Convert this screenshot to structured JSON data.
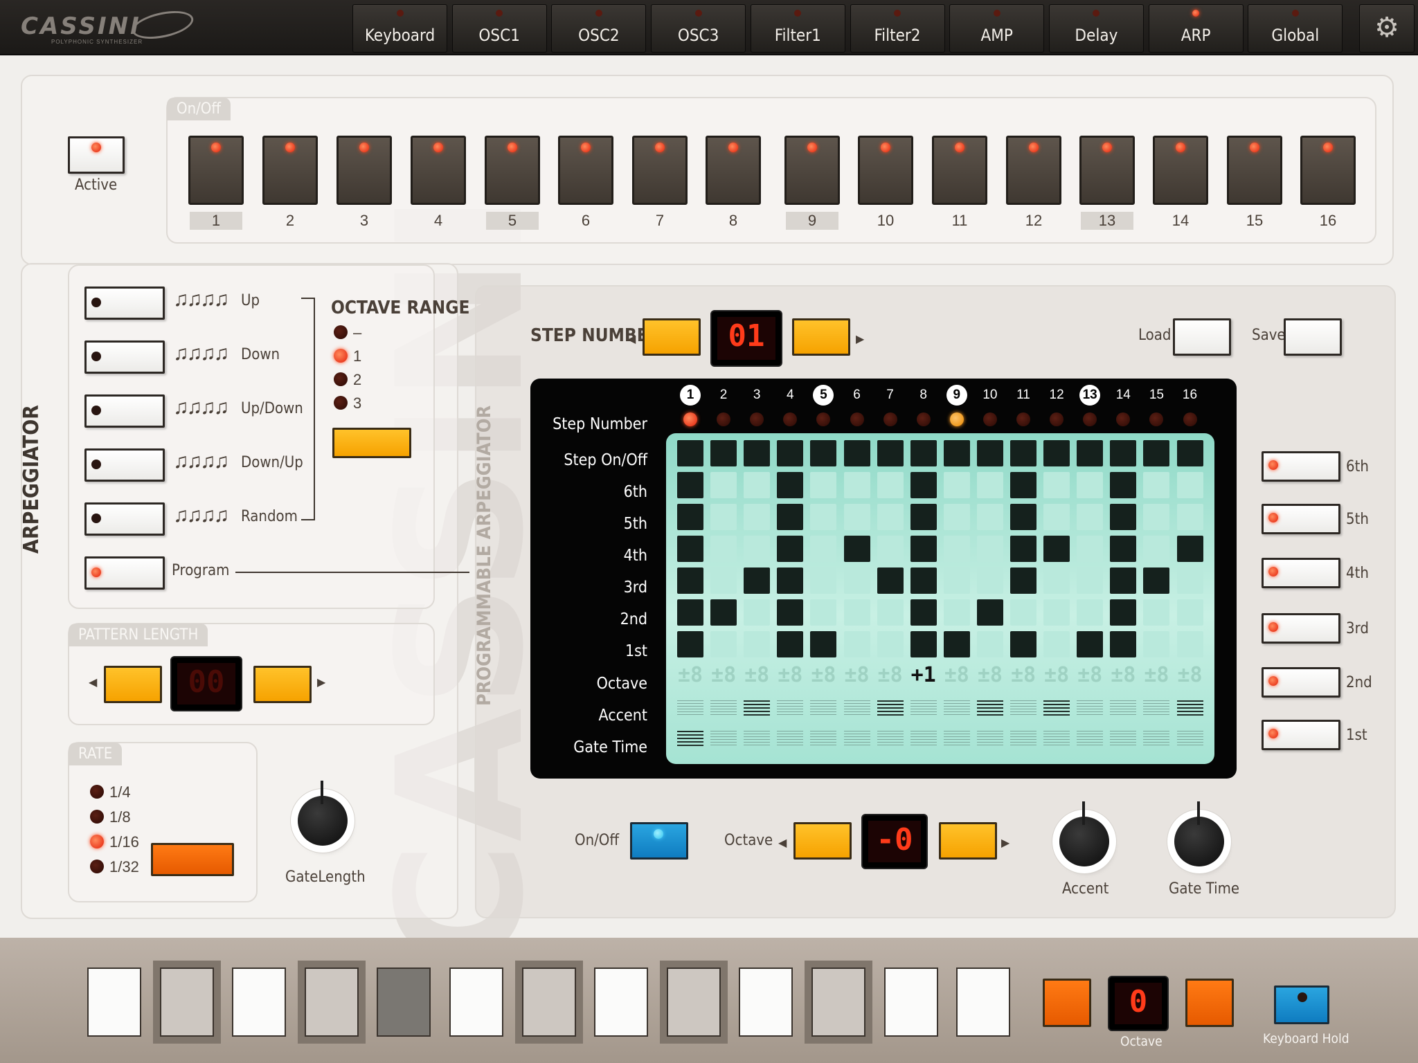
{
  "app": {
    "logo": "CASSINI",
    "logo_sub": "POLYPHONIC SYNTHESIZER"
  },
  "tabs": [
    {
      "label": "Keyboard",
      "active": false
    },
    {
      "label": "OSC1",
      "active": false
    },
    {
      "label": "OSC2",
      "active": false
    },
    {
      "label": "OSC3",
      "active": false
    },
    {
      "label": "Filter1",
      "active": false
    },
    {
      "label": "Filter2",
      "active": false
    },
    {
      "label": "AMP",
      "active": false
    },
    {
      "label": "Delay",
      "active": false
    },
    {
      "label": "ARP",
      "active": true
    },
    {
      "label": "Global",
      "active": false
    }
  ],
  "arp_section": {
    "title": "ARPEGGIATOR",
    "on_off_tag": "On/Off",
    "active_label": "Active",
    "steps": [
      "1",
      "2",
      "3",
      "4",
      "5",
      "6",
      "7",
      "8",
      "9",
      "10",
      "11",
      "12",
      "13",
      "14",
      "15",
      "16"
    ],
    "highlighted_steps": [
      1,
      5,
      9,
      13
    ],
    "modes": [
      {
        "label": "Up",
        "on": false
      },
      {
        "label": "Down",
        "on": false
      },
      {
        "label": "Up/Down",
        "on": false
      },
      {
        "label": "Down/Up",
        "on": false
      },
      {
        "label": "Random",
        "on": false
      },
      {
        "label": "Program",
        "on": true
      }
    ],
    "octave_range": {
      "title": "OCTAVE RANGE",
      "options": [
        "–",
        "1",
        "2",
        "3"
      ],
      "selected": "1"
    },
    "pattern_length": {
      "title": "PATTERN LENGTH",
      "display": "00"
    },
    "rate": {
      "title": "RATE",
      "options": [
        "1/4",
        "1/8",
        "1/16",
        "1/32"
      ],
      "selected": "1/16"
    },
    "gate_length_label": "GateLength"
  },
  "prog_arp": {
    "title": "PROGRAMMABLE ARPEGGIATOR",
    "step_number_label": "STEP NUMBER",
    "step_display": "01",
    "load_label": "Load",
    "save_label": "Save",
    "row_labels": [
      "Step Number",
      "Step On/Off",
      "6th",
      "5th",
      "4th",
      "3rd",
      "2nd",
      "1st",
      "Octave",
      "Accent",
      "Gate Time"
    ],
    "columns": [
      "1",
      "2",
      "3",
      "4",
      "5",
      "6",
      "7",
      "8",
      "9",
      "10",
      "11",
      "12",
      "13",
      "14",
      "15",
      "16"
    ],
    "highlighted_columns": [
      1,
      5,
      9,
      13
    ],
    "octave_values": [
      "±8",
      "±8",
      "±8",
      "±8",
      "±8",
      "±8",
      "±8",
      "+1",
      "±8",
      "±8",
      "±8",
      "±8",
      "±8",
      "±8",
      "±8",
      "±8"
    ],
    "note_buttons": [
      "6th",
      "5th",
      "4th",
      "3rd",
      "2nd",
      "1st"
    ],
    "on_off_label": "On/Off",
    "octave_label": "Octave",
    "octave_display": "-0",
    "accent_label": "Accent",
    "gate_time_label": "Gate Time"
  },
  "keyboard": {
    "octave_label": "Octave",
    "octave_display": "0",
    "hold_label": "Keyboard Hold"
  },
  "colors": {
    "accent_orange": "#f6a200",
    "deep_orange": "#e65a00",
    "led_red": "#e3200a",
    "lcd_teal": "#b9e9dc",
    "hold_blue": "#0f7cc0"
  }
}
